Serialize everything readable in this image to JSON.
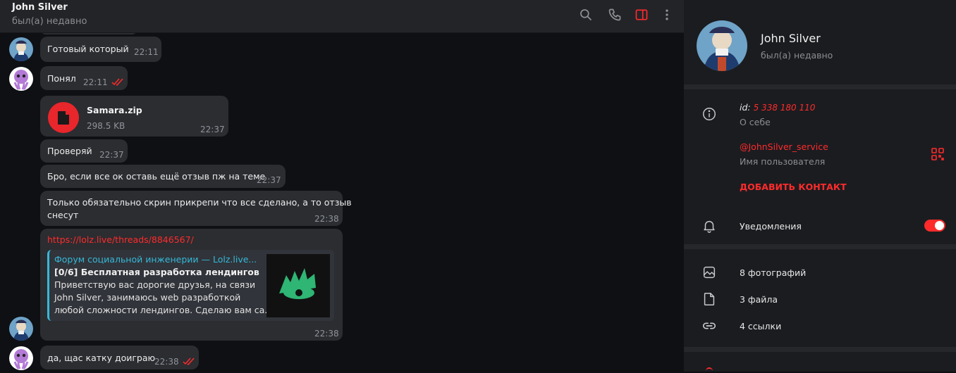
{
  "header": {
    "name": "John Silver",
    "status": "был(а) недавно",
    "icons": [
      "search-icon",
      "phone-icon",
      "sidebar-toggle-icon",
      "more-icon"
    ]
  },
  "messages": [
    {
      "text": "Готовый который",
      "time": "22:11"
    },
    {
      "text": "Понял",
      "time": "22:11"
    },
    {
      "file_name": "Samara.zip",
      "file_size": "298.5 KB",
      "time": "22:37"
    },
    {
      "text": "Проверяй",
      "time": "22:37"
    },
    {
      "text": "Бро, если все ок оставь ещё отзыв пж на теме",
      "time": "22:37"
    },
    {
      "text_line1": "Только обязательно скрин прикрепи что все сделано, а то отзыв",
      "text_line2": "снесут",
      "time": "22:38"
    },
    {
      "link": "https://lolz.live/threads/8846567/",
      "preview_site": "Форум социальной инженерии — Lolz.live...",
      "preview_title": "[0/6] Бесплатная разработка лендингов",
      "preview_desc_1": "Приветствую вас дорогие друзья, на связи",
      "preview_desc_2": "John Silver, занимаюсь web разработкой",
      "preview_desc_3": "любой сложности лендингов. Сделаю вам са...",
      "time": "22:38"
    },
    {
      "text": "да, щас катку доиграю",
      "time": "22:38"
    }
  ],
  "profile": {
    "name": "John Silver",
    "status": "был(а) недавно",
    "id_label": "id:",
    "id_value": "5 338 180 110",
    "about_label": "О себе",
    "username": "@JohnSilver_service",
    "username_label": "Имя пользователя",
    "add_contact": "ДОБАВИТЬ КОНТАКТ",
    "notifications": "Уведомления",
    "notifications_on": true,
    "photos": "8 фотографий",
    "files": "3 файла",
    "links": "4 ссылки"
  },
  "colors": {
    "accent": "#ff2b2b",
    "link_preview_accent": "#35b8d8",
    "bubble": "#2b2d31",
    "panel": "#1b1c20"
  }
}
